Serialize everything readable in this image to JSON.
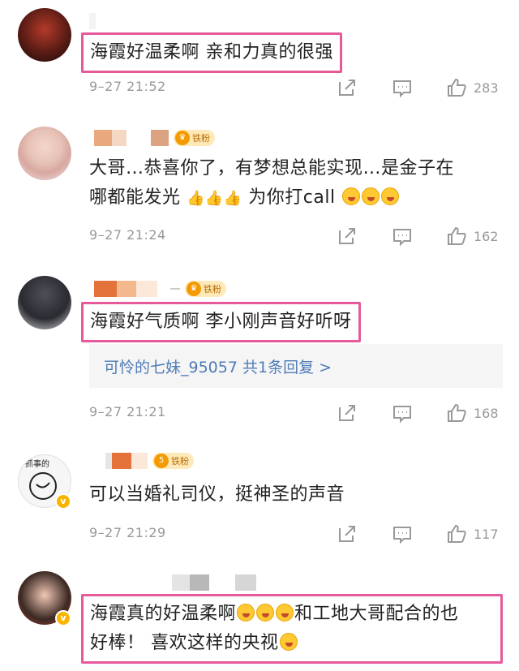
{
  "comments": [
    {
      "text": "海霞好温柔啊 亲和力真的很强",
      "time": "9–27 21:52",
      "likes": "283"
    },
    {
      "badge": "铁粉",
      "text_line1": "大哥…恭喜你了，有梦想总能实现…是金子在",
      "text_line2a": "哪都能发光",
      "text_line2b": "为你打call",
      "time": "9–27 21:24",
      "likes": "162"
    },
    {
      "badge": "铁粉",
      "text": "海霞好气质啊 李小刚声音好听呀",
      "reply_preview": "可怜的七妹_95057  共1条回复 >",
      "time": "9–27 21:21",
      "likes": "168"
    },
    {
      "badge": "铁粉",
      "badge_level": "5",
      "text": "可以当婚礼司仪，挺神圣的声音",
      "time": "9–27 21:29",
      "likes": "117"
    },
    {
      "text_line1a": "海霞真的好温柔啊",
      "text_line1b": "和工地大哥配合的也",
      "text_line2": "好棒！ 喜欢这样的央视"
    }
  ],
  "icons": {
    "forward": "share-icon",
    "comment": "comment-icon",
    "like": "thumbs-up-icon",
    "verified": "verified-badge-icon",
    "crown": "crown-icon"
  },
  "colors": {
    "highlight_border": "#e65a9b",
    "reply_link": "#4e7bb8",
    "meta_gray": "#999999",
    "fan_badge_bg": "#ffe9b8"
  }
}
